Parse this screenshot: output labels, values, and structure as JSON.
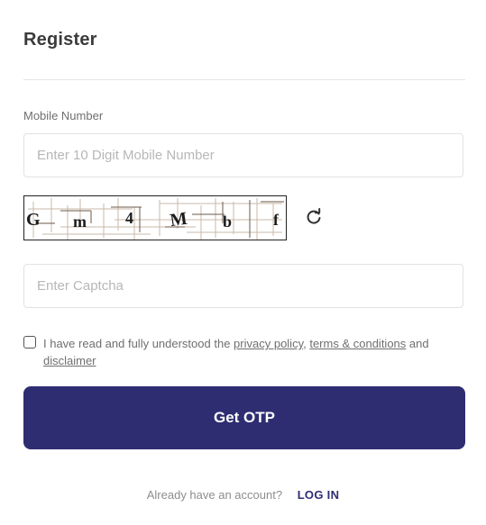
{
  "header": {
    "title": "Register"
  },
  "mobile": {
    "label": "Mobile Number",
    "placeholder": "Enter 10 Digit Mobile Number",
    "value": ""
  },
  "captcha": {
    "characters": [
      "G",
      "m",
      "4",
      "M",
      "b",
      "f"
    ],
    "input_placeholder": "Enter Captcha",
    "input_value": "",
    "refresh_icon": "refresh-icon"
  },
  "consent": {
    "checked": false,
    "prefix": "I have read and fully understood the ",
    "privacy_link": "privacy policy",
    "sep1": ", ",
    "terms_link": "terms & conditions",
    "sep2": " and ",
    "disclaimer_link": "disclaimer"
  },
  "actions": {
    "get_otp_label": "Get OTP"
  },
  "footer": {
    "question": "Already have an account?",
    "login_label": "LOG IN"
  },
  "colors": {
    "primary": "#2e2d72",
    "border": "#e2e2e2",
    "placeholder": "#b7b7b7",
    "muted_text": "#6f6f6f"
  }
}
